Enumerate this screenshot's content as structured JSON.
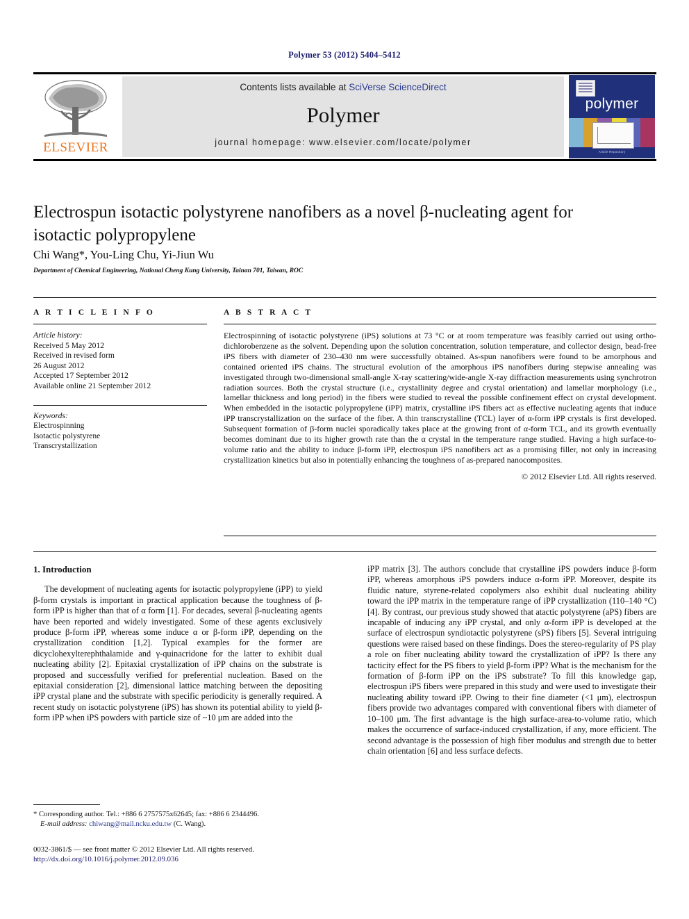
{
  "running_head": "Polymer 53 (2012) 5404–5412",
  "masthead": {
    "publisher_logo_label": "ELSEVIER",
    "contents_prefix": "Contents lists available at ",
    "contents_link": "SciVerse ScienceDirect",
    "journal_name": "Polymer",
    "homepage": "journal homepage: www.elsevier.com/locate/polymer",
    "cover": {
      "title": "polymer",
      "footer": "Article Repository"
    },
    "colors": {
      "elsevier_orange": "#E87722",
      "link_blue": "#2b3a8f",
      "cover_blue": "#21307a",
      "banner_gray": "#e3e3e3"
    }
  },
  "article": {
    "title": "Electrospun isotactic polystyrene nanofibers as a novel β-nucleating agent for isotactic polypropylene",
    "authors": "Chi Wang*, You-Ling Chu, Yi-Jiun Wu",
    "affiliation": "Department of Chemical Engineering, National Cheng Kung University, Tainan 701, Taiwan, ROC"
  },
  "article_info": {
    "heading": "A R T I C L E   I N F O",
    "history_label": "Article history:",
    "history": [
      "Received 5 May 2012",
      "Received in revised form",
      "26 August 2012",
      "Accepted 17 September 2012",
      "Available online 21 September 2012"
    ],
    "keywords_label": "Keywords:",
    "keywords": [
      "Electrospinning",
      "Isotactic polystyrene",
      "Transcrystallization"
    ]
  },
  "abstract": {
    "heading": "A B S T R A C T",
    "text": "Electrospinning of isotactic polystyrene (iPS) solutions at 73 °C or at room temperature was feasibly carried out using ortho-dichlorobenzene as the solvent. Depending upon the solution concentration, solution temperature, and collector design, bead-free iPS fibers with diameter of 230–430 nm were successfully obtained. As-spun nanofibers were found to be amorphous and contained oriented iPS chains. The structural evolution of the amorphous iPS nanofibers during stepwise annealing was investigated through two-dimensional small-angle X-ray scattering/wide-angle X-ray diffraction measurements using synchrotron radiation sources. Both the crystal structure (i.e., crystallinity degree and crystal orientation) and lamellar morphology (i.e., lamellar thickness and long period) in the fibers were studied to reveal the possible confinement effect on crystal development. When embedded in the isotactic polypropylene (iPP) matrix, crystalline iPS fibers act as effective nucleating agents that induce iPP transcrystallization on the surface of the fiber. A thin transcrystalline (TCL) layer of α-form iPP crystals is first developed. Subsequent formation of β-form nuclei sporadically takes place at the growing front of α-form TCL, and its growth eventually becomes dominant due to its higher growth rate than the α crystal in the temperature range studied. Having a high surface-to-volume ratio and the ability to induce β-form iPP, electrospun iPS nanofibers act as a promising filler, not only in increasing crystallization kinetics but also in potentially enhancing the toughness of as-prepared nanocomposites.",
    "copyright": "© 2012 Elsevier Ltd. All rights reserved."
  },
  "introduction": {
    "heading": "1. Introduction",
    "left_paragraph_1": "The development of nucleating agents for isotactic polypropylene (iPP) to yield β-form crystals is important in practical application because the toughness of β-form iPP is higher than that of α form [1]. For decades, several β-nucleating agents have been reported and widely investigated. Some of these agents exclusively produce β-form iPP, whereas some induce α or β-form iPP, depending on the crystallization condition [1,2]. Typical examples for the former are dicyclohexylterephthalamide and γ-quinacridone for the latter to exhibit dual nucleating ability [2]. Epitaxial crystallization of iPP chains on the substrate is proposed and successfully verified for preferential nucleation. Based on the epitaxial consideration [2], dimensional lattice matching between the depositing iPP crystal plane and the substrate with specific periodicity is generally required. A recent study on isotactic polystyrene (iPS) has shown its potential ability to yield β-form iPP when iPS powders with particle size of ~10 μm are added into the",
    "right_paragraph_1": "iPP matrix [3]. The authors conclude that crystalline iPS powders induce β-form iPP, whereas amorphous iPS powders induce α-form iPP. Moreover, despite its fluidic nature, styrene-related copolymers also exhibit dual nucleating ability toward the iPP matrix in the temperature range of iPP crystallization (110–140 °C) [4]. By contrast, our previous study showed that atactic polystyrene (aPS) fibers are incapable of inducing any iPP crystal, and only α-form iPP is developed at the surface of electrospun syndiotactic polystyrene (sPS) fibers [5]. Several intriguing questions were raised based on these findings. Does the stereo-regularity of PS play a role on fiber nucleating ability toward the crystallization of iPP? Is there any tacticity effect for the PS fibers to yield β-form iPP? What is the mechanism for the formation of β-form iPP on the iPS substrate? To fill this knowledge gap, electrospun iPS fibers were prepared in this study and were used to investigate their nucleating ability toward iPP. Owing to their fine diameter (<1 μm), electrospun fibers provide two advantages compared with conventional fibers with diameter of 10–100 μm. The first advantage is the high surface-area-to-volume ratio, which makes the occurrence of surface-induced crystallization, if any, more efficient. The second advantage is the possession of high fiber modulus and strength due to better chain orientation [6] and less surface defects."
  },
  "footnotes": {
    "corresponding": "* Corresponding author. Tel.: +886 6 2757575x62645; fax: +886 6 2344496.",
    "email_label": "E-mail address:",
    "email": "chiwang@mail.ncku.edu.tw",
    "email_suffix": " (C. Wang).",
    "imprint": "0032-3861/$ — see front matter © 2012 Elsevier Ltd. All rights reserved.",
    "doi": "http://dx.doi.org/10.1016/j.polymer.2012.09.036"
  }
}
